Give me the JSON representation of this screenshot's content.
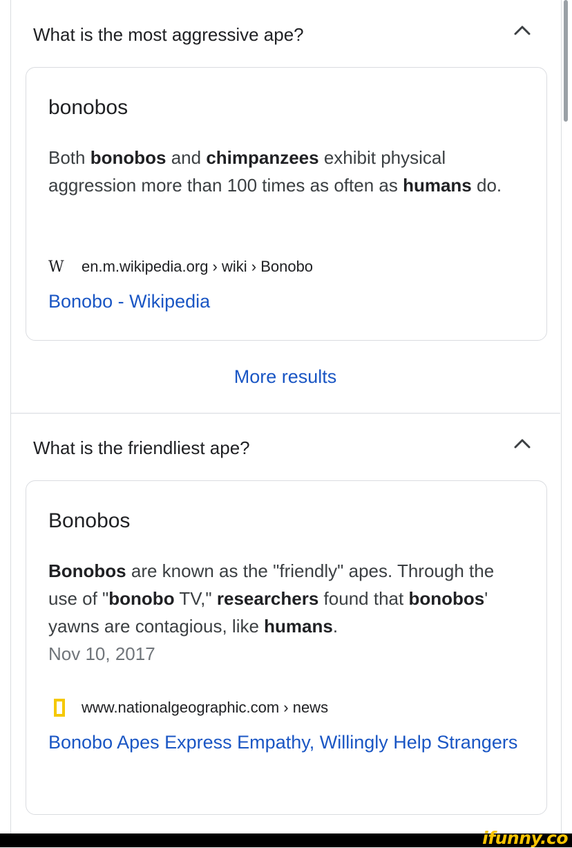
{
  "qa_blocks": [
    {
      "question": "What is the most aggressive ape?",
      "answer_title": "bonobos",
      "snippet": [
        {
          "text": "Both ",
          "bold": false
        },
        {
          "text": "bonobos",
          "bold": true
        },
        {
          "text": " and ",
          "bold": false
        },
        {
          "text": "chimpanzees",
          "bold": true
        },
        {
          "text": " exhibit physical aggression more than 100 times as often as ",
          "bold": false
        },
        {
          "text": "humans",
          "bold": true
        },
        {
          "text": " do.",
          "bold": false
        }
      ],
      "date": "",
      "source_icon": "wikipedia-w-icon",
      "source_icon_glyph": "W",
      "source_url": "en.m.wikipedia.org › wiki › Bonobo",
      "link_text": "Bonobo - Wikipedia"
    },
    {
      "question": "What is the friendliest ape?",
      "answer_title": "Bonobos",
      "snippet": [
        {
          "text": "Bonobos",
          "bold": true
        },
        {
          "text": " are known as the \"friendly\" apes. Through the use of \"",
          "bold": false
        },
        {
          "text": "bonobo",
          "bold": true
        },
        {
          "text": " TV,\" ",
          "bold": false
        },
        {
          "text": "researchers",
          "bold": true
        },
        {
          "text": " found that ",
          "bold": false
        },
        {
          "text": "bonobos",
          "bold": true
        },
        {
          "text": "' yawns are contagious, like ",
          "bold": false
        },
        {
          "text": "humans",
          "bold": true
        },
        {
          "text": ".",
          "bold": false
        }
      ],
      "date": "Nov 10, 2017",
      "source_icon": "national-geographic-icon",
      "source_url": "www.nationalgeographic.com › news",
      "link_text": "Bonobo Apes Express Empathy, Willingly Help Strangers"
    }
  ],
  "more_results_label": "More results",
  "watermark": "ifunny.co",
  "colors": {
    "link": "#1a56c4",
    "text": "#202124",
    "natgeo_yellow": "#f5c800",
    "watermark_yellow": "#f7c300"
  }
}
